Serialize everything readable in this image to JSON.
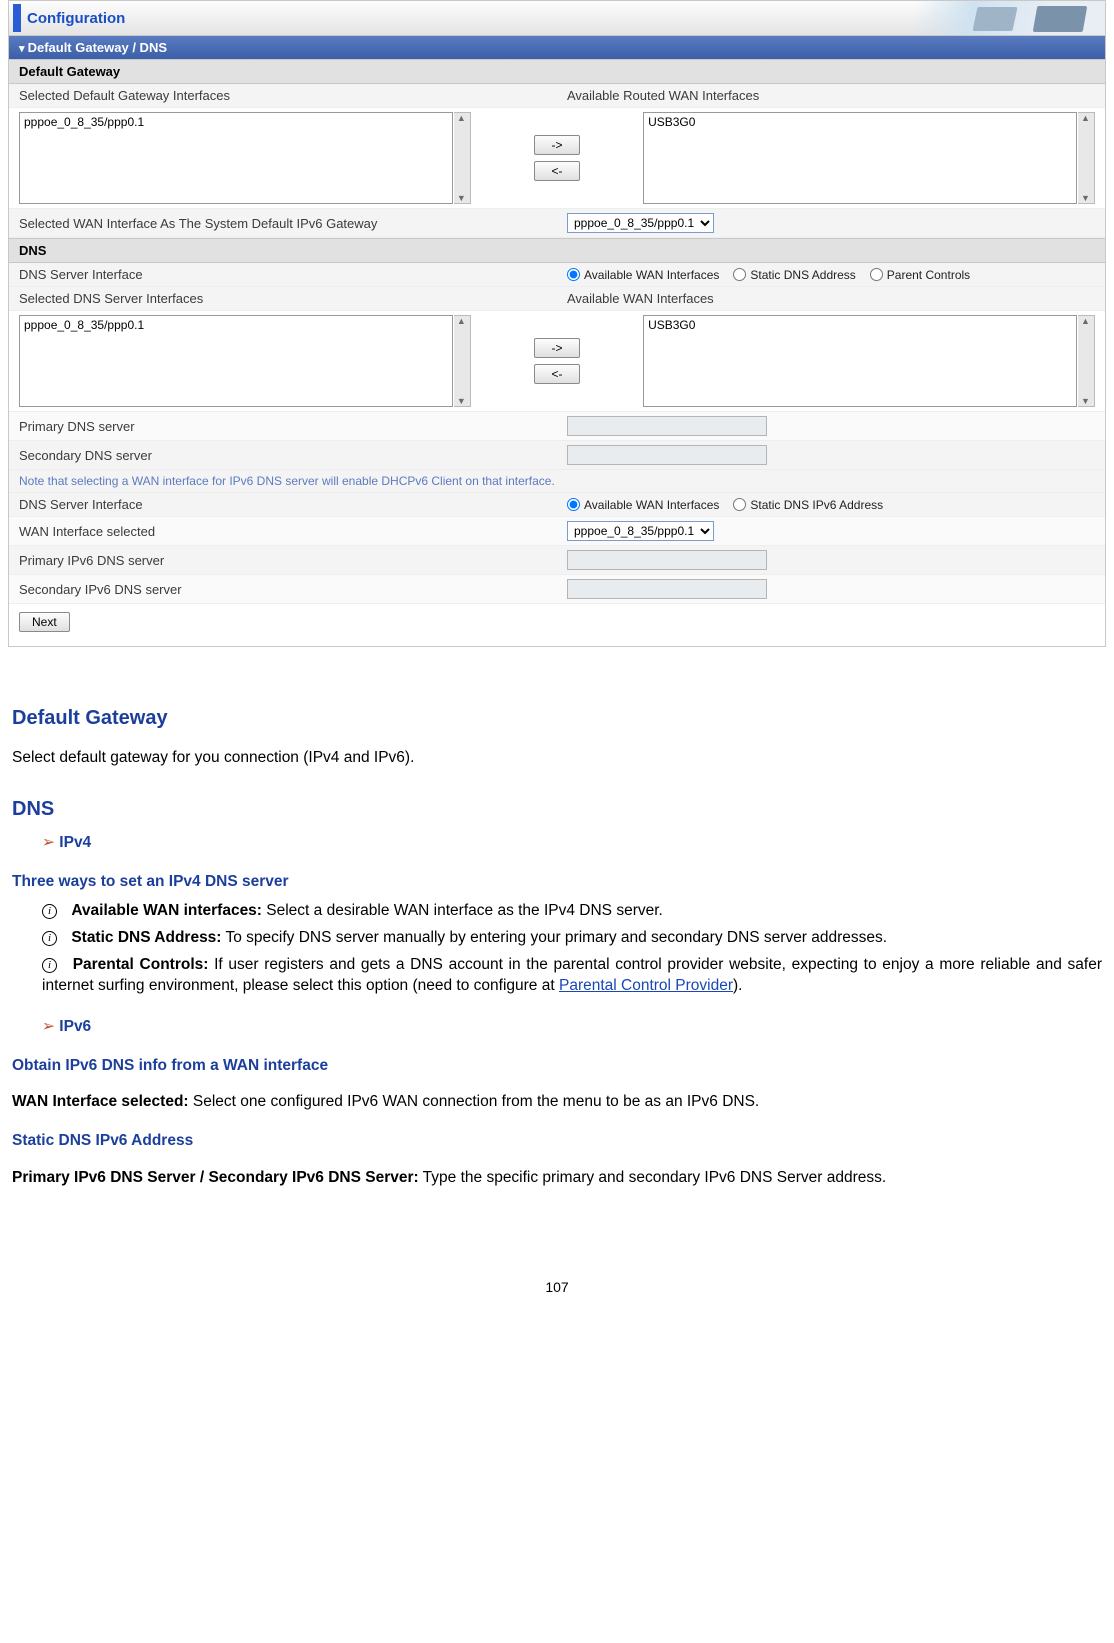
{
  "header": {
    "title": "Configuration"
  },
  "panel": {
    "title": "Default Gateway / DNS",
    "gw_section": "Default Gateway",
    "dns_section": "DNS",
    "labels": {
      "sel_gw_ifaces": "Selected Default Gateway Interfaces",
      "avail_routed": "Available Routed WAN Interfaces",
      "sel_wan_ipv6_gw": "Selected WAN Interface As The System Default IPv6 Gateway",
      "dns_srv_iface": "DNS Server Interface",
      "sel_dns_ifaces": "Selected DNS Server Interfaces",
      "avail_wan": "Available WAN Interfaces",
      "primary_dns": "Primary DNS server",
      "secondary_dns": "Secondary DNS server",
      "wan_iface_selected": "WAN Interface selected",
      "primary_v6_dns": "Primary IPv6 DNS server",
      "secondary_v6_dns": "Secondary IPv6 DNS server"
    },
    "lists": {
      "gw_selected": [
        "pppoe_0_8_35/ppp0.1"
      ],
      "gw_avail": [
        "USB3G0"
      ],
      "dns_selected": [
        "pppoe_0_8_35/ppp0.1"
      ],
      "dns_avail": [
        "USB3G0"
      ]
    },
    "selects": {
      "ipv6_gw": "pppoe_0_8_35/ppp0.1",
      "ipv6_wan": "pppoe_0_8_35/ppp0.1"
    },
    "radios": {
      "dns_v4": {
        "avail": "Available WAN Interfaces",
        "static": "Static DNS Address",
        "parent": "Parent Controls"
      },
      "dns_v6": {
        "avail": "Available WAN Interfaces",
        "static": "Static DNS IPv6 Address"
      }
    },
    "note": "Note that selecting a WAN interface for IPv6 DNS server will enable DHCPv6 Client on that interface.",
    "arrow_right": "->",
    "arrow_left": "<-",
    "next_btn": "Next"
  },
  "doc": {
    "h_gw": "Default Gateway",
    "p_gw": "Select default gateway for you connection (IPv4 and IPv6).",
    "h_dns": "DNS",
    "h_ipv4": "IPv4",
    "h_three": "Three ways to set an IPv4 DNS server",
    "li1_b": "Available WAN interfaces:",
    "li1_t": " Select a desirable WAN interface as the IPv4 DNS server.",
    "li2_b": "Static DNS Address:",
    "li2_t": " To specify DNS server manually by entering your primary and secondary DNS server addresses.",
    "li3_b": "Parental Controls:",
    "li3_t1": " If user registers and gets a DNS account in the parental control provider website, expecting to enjoy a more reliable and safer internet surfing environment, please select this option (need to configure at ",
    "li3_link": "Parental Control Provider",
    "li3_t2": ").",
    "h_ipv6": "IPv6",
    "h_obtain": "Obtain IPv6 DNS info from a WAN interface",
    "p_wan_sel_b": "WAN Interface selected:",
    "p_wan_sel_t": " Select one configured IPv6 WAN connection from the menu to be as an IPv6 DNS.",
    "h_static6": "Static DNS IPv6 Address",
    "p_static6_b": "Primary IPv6 DNS Server / Secondary IPv6 DNS Server:",
    "p_static6_t": " Type the specific primary and secondary IPv6 DNS Server address."
  },
  "page_number": "107"
}
